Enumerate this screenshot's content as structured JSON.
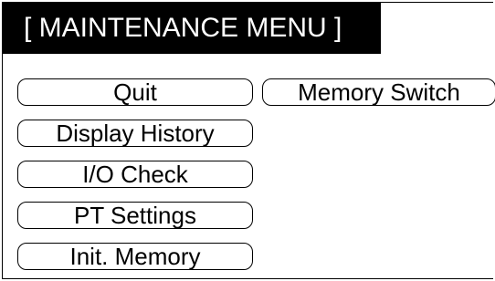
{
  "title": "[ MAINTENANCE MENU ]",
  "left_column": [
    {
      "label": "Quit"
    },
    {
      "label": "Display History"
    },
    {
      "label": "I/O Check"
    },
    {
      "label": "PT Settings"
    },
    {
      "label": "Init. Memory"
    }
  ],
  "right_column": [
    {
      "label": "Memory Switch"
    }
  ],
  "colors": {
    "title_bg": "#000000",
    "title_text": "#ffffff",
    "button_border": "#000000",
    "background": "#ffffff"
  }
}
